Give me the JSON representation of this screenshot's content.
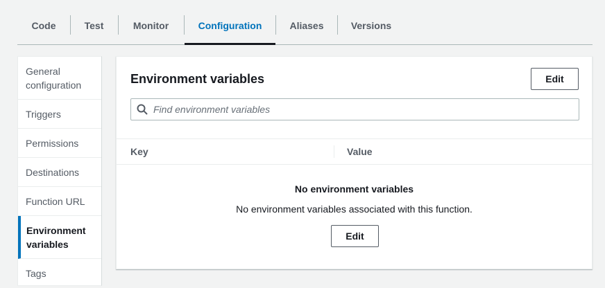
{
  "tabs": [
    {
      "label": "Code"
    },
    {
      "label": "Test"
    },
    {
      "label": "Monitor"
    },
    {
      "label": "Configuration"
    },
    {
      "label": "Aliases"
    },
    {
      "label": "Versions"
    }
  ],
  "active_tab": "Configuration",
  "sidebar": {
    "items": [
      {
        "label": "General configuration"
      },
      {
        "label": "Triggers"
      },
      {
        "label": "Permissions"
      },
      {
        "label": "Destinations"
      },
      {
        "label": "Function URL"
      },
      {
        "label": "Environment variables"
      },
      {
        "label": "Tags"
      }
    ],
    "active": "Environment variables"
  },
  "panel": {
    "title": "Environment variables",
    "edit_label": "Edit",
    "search_placeholder": "Find environment variables",
    "columns": [
      "Key",
      "Value"
    ],
    "empty_title": "No environment variables",
    "empty_description": "No environment variables associated with this function.",
    "empty_edit_label": "Edit"
  },
  "colors": {
    "accent": "#0073bb",
    "background": "#f2f3f3",
    "text": "#16191f",
    "muted": "#545b64"
  }
}
